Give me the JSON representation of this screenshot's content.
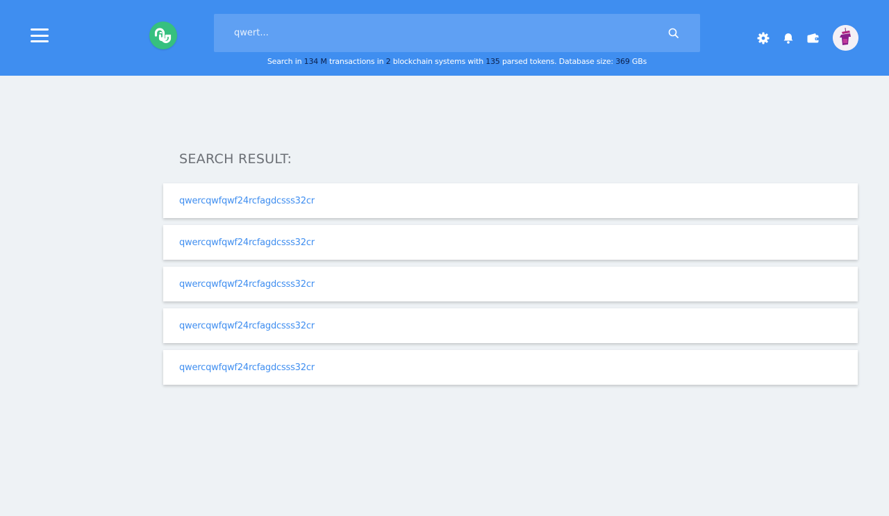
{
  "header": {
    "search": {
      "placeholder": "qwert..."
    },
    "stats": {
      "prefix": "Search in",
      "transactions": "134 M",
      "transactions_text": "transactions in",
      "systems": "2",
      "systems_text": "blockchain systems with",
      "tokens": "135",
      "tokens_text": "parsed tokens. Database size:",
      "db_size": "369",
      "db_unit": "GBs"
    },
    "icons": [
      "menu-icon",
      "stumbleupon-logo-icon",
      "search-icon",
      "gear-icon",
      "bell-icon",
      "wallet-icon",
      "avatar"
    ]
  },
  "main": {
    "title": "SEARCH RESULT:",
    "results": [
      {
        "label": "qwercqwfqwf24rcfagdcsss32cr"
      },
      {
        "label": "qwercqwfqwf24rcfagdcsss32cr"
      },
      {
        "label": "qwercqwfqwf24rcfagdcsss32cr"
      },
      {
        "label": "qwercqwfqwf24rcfagdcsss32cr"
      },
      {
        "label": "qwercqwfqwf24rcfagdcsss32cr"
      }
    ]
  },
  "colors": {
    "header_bg": "#3f8ef0",
    "search_bg": "#5fa0f3",
    "logo_green": "#36c07f",
    "link": "#3f8ef0",
    "page_bg": "#eef2f5",
    "stat_number": "#0b1f4a"
  }
}
